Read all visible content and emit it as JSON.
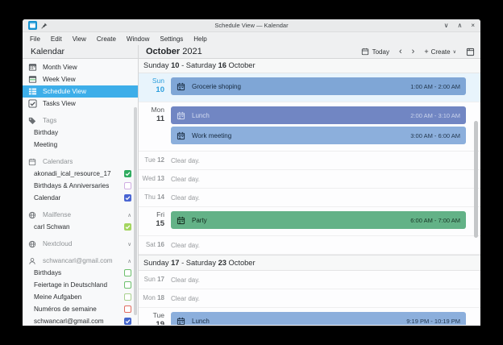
{
  "window": {
    "title": "Schedule View — Kalendar",
    "controls": {
      "minimize": "∨",
      "maximize": "∧",
      "close": "×"
    }
  },
  "menu": {
    "items": [
      "File",
      "Edit",
      "View",
      "Create",
      "Window",
      "Settings",
      "Help"
    ]
  },
  "toolbar": {
    "sidebar_title": "Kalendar",
    "month": "October",
    "year": "2021",
    "today_label": "Today",
    "prev_icon": "‹",
    "next_icon": "›",
    "plus_icon": "+",
    "create_label": "Create",
    "create_caret": "∨"
  },
  "sidebar": {
    "views": [
      {
        "label": "Month View",
        "icon": "month-view-icon",
        "selected": false
      },
      {
        "label": "Week View",
        "icon": "week-view-icon",
        "selected": false
      },
      {
        "label": "Schedule View",
        "icon": "schedule-view-icon",
        "selected": true
      },
      {
        "label": "Tasks View",
        "icon": "tasks-view-icon",
        "selected": false
      }
    ],
    "sections": [
      {
        "header": {
          "label": "Tags",
          "icon": "tag-icon"
        },
        "items": [
          {
            "label": "Birthday"
          },
          {
            "label": "Meeting"
          }
        ]
      },
      {
        "header": {
          "label": "Calendars",
          "icon": "calendar-icon"
        },
        "items": [
          {
            "label": "akonadi_ical_resource_17",
            "checkbox": {
              "checked": true,
              "color": "#2eab5f"
            }
          },
          {
            "label": "Birthdays & Anniversaries",
            "checkbox": {
              "checked": false,
              "color": "#d0aee2"
            }
          },
          {
            "label": "Calendar",
            "checkbox": {
              "checked": true,
              "color": "#4965d2"
            }
          }
        ]
      },
      {
        "header": {
          "label": "Mailfense",
          "icon": "globe-icon",
          "chevron": "up"
        },
        "items": [
          {
            "label": "carl Schwan",
            "checkbox": {
              "checked": true,
              "color": "#a3d55f"
            }
          }
        ]
      },
      {
        "header": {
          "label": "Nextcloud",
          "icon": "globe-icon",
          "chevron": "down"
        },
        "items": []
      },
      {
        "header": {
          "label": "schwancarl@gmail.com",
          "icon": "account-icon",
          "chevron": "up"
        },
        "items": [
          {
            "label": "Birthdays",
            "checkbox": {
              "checked": false,
              "color": "#6cbf6c"
            }
          },
          {
            "label": "Feiertage in Deutschland",
            "checkbox": {
              "checked": false,
              "color": "#6cbf6c"
            }
          },
          {
            "label": "Meine Aufgaben",
            "checkbox": {
              "checked": false,
              "color": "#a8d08d"
            }
          },
          {
            "label": "Numéros de semaine",
            "checkbox": {
              "checked": false,
              "color": "#e06c60"
            }
          },
          {
            "label": "schwancarl@gmail.com",
            "checkbox": {
              "checked": true,
              "color": "#4466cc"
            }
          }
        ]
      }
    ]
  },
  "schedule": {
    "clear_label": "Clear day.",
    "weeks": [
      {
        "title": {
          "start_name": "Sunday",
          "start_num": "10",
          "mid": "- Saturday",
          "end_num": "16",
          "month": "October"
        },
        "days": [
          {
            "name": "Sun",
            "num": "10",
            "today": true,
            "events": [
              {
                "title": "Grocerie shoping",
                "time": "1:00 AM - 2:00 AM",
                "bg": "#7fa6d6",
                "fg": "#16293e"
              }
            ]
          },
          {
            "name": "Mon",
            "num": "11",
            "events": [
              {
                "title": "Lunch",
                "time": "2:00 AM - 3:10 AM",
                "bg": "#7186c3",
                "fg": "#d4dcf1"
              },
              {
                "title": "Work meeting",
                "time": "3:00 AM - 6:00 AM",
                "bg": "#8cafdc",
                "fg": "#16293e"
              }
            ]
          },
          {
            "name": "Tue",
            "num": "12",
            "clear": true
          },
          {
            "name": "Wed",
            "num": "13",
            "clear": true
          },
          {
            "name": "Thu",
            "num": "14",
            "clear": true
          },
          {
            "name": "Fri",
            "num": "15",
            "events": [
              {
                "title": "Party",
                "time": "6:00 AM - 7:00 AM",
                "bg": "#63b287",
                "fg": "#122a1d"
              }
            ]
          },
          {
            "name": "Sat",
            "num": "16",
            "clear": true
          }
        ]
      },
      {
        "title": {
          "start_name": "Sunday",
          "start_num": "17",
          "mid": "- Saturday",
          "end_num": "23",
          "month": "October"
        },
        "days": [
          {
            "name": "Sun",
            "num": "17",
            "clear": true
          },
          {
            "name": "Mon",
            "num": "18",
            "clear": true
          },
          {
            "name": "Tue",
            "num": "19",
            "events": [
              {
                "title": "Lunch",
                "time": "9:19 PM - 10:19 PM",
                "bg": "#8cafdc",
                "fg": "#16293e"
              }
            ]
          }
        ]
      }
    ]
  },
  "colors": {
    "accent": "#3daee9",
    "today_row": "#e8f4fc"
  }
}
